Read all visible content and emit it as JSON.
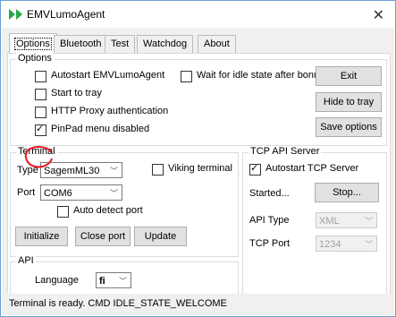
{
  "window": {
    "title": "EMVLumoAgent",
    "close_glyph": "✕"
  },
  "tabs": [
    {
      "label": "Options",
      "active": true
    },
    {
      "label": "Bluetooth",
      "active": false
    },
    {
      "label": "Test",
      "active": false
    },
    {
      "label": "Watchdog",
      "active": false
    },
    {
      "label": "About",
      "active": false
    }
  ],
  "options": {
    "group_label": "Options",
    "autostart": {
      "label": "Autostart EMVLumoAgent",
      "checked": false
    },
    "start_to_tray": {
      "label": "Start to tray",
      "checked": false
    },
    "http_proxy": {
      "label": "HTTP Proxy authentication",
      "checked": false
    },
    "pinpad_menu": {
      "label": "PinPad menu disabled",
      "checked": true
    },
    "wait_idle": {
      "label": "Wait for idle state after bonus",
      "checked": false
    },
    "exit_label": "Exit",
    "hide_to_tray_label": "Hide to tray",
    "save_options_label": "Save options"
  },
  "terminal": {
    "group_label": "Terminal",
    "type_label": "Type",
    "type_value": "SagemML30",
    "viking": {
      "label": "Viking terminal",
      "checked": false
    },
    "port_label": "Port",
    "port_value": "COM6",
    "auto_detect": {
      "label": "Auto detect port",
      "checked": false
    },
    "initialize_label": "Initialize",
    "close_port_label": "Close port",
    "update_label": "Update"
  },
  "tcp": {
    "group_label": "TCP API Server",
    "autostart": {
      "label": "Autostart TCP Server",
      "checked": true
    },
    "status_text": "Started...",
    "stop_label": "Stop...",
    "api_type_label": "API Type",
    "api_type_value": "XML",
    "port_label": "TCP Port",
    "port_value": "1234"
  },
  "api": {
    "group_label": "API",
    "language_label": "Language",
    "language_value": "fi"
  },
  "status_bar": {
    "text": "Terminal is ready.  CMD IDLE_STATE_WELCOME"
  },
  "colors": {
    "accent_border": "#6fa0d8",
    "annotation_red": "#e8141e",
    "icon_green": "#27a844"
  },
  "icons": {
    "app": "double-arrow-icon",
    "dropdown": "chevron-down-icon"
  }
}
